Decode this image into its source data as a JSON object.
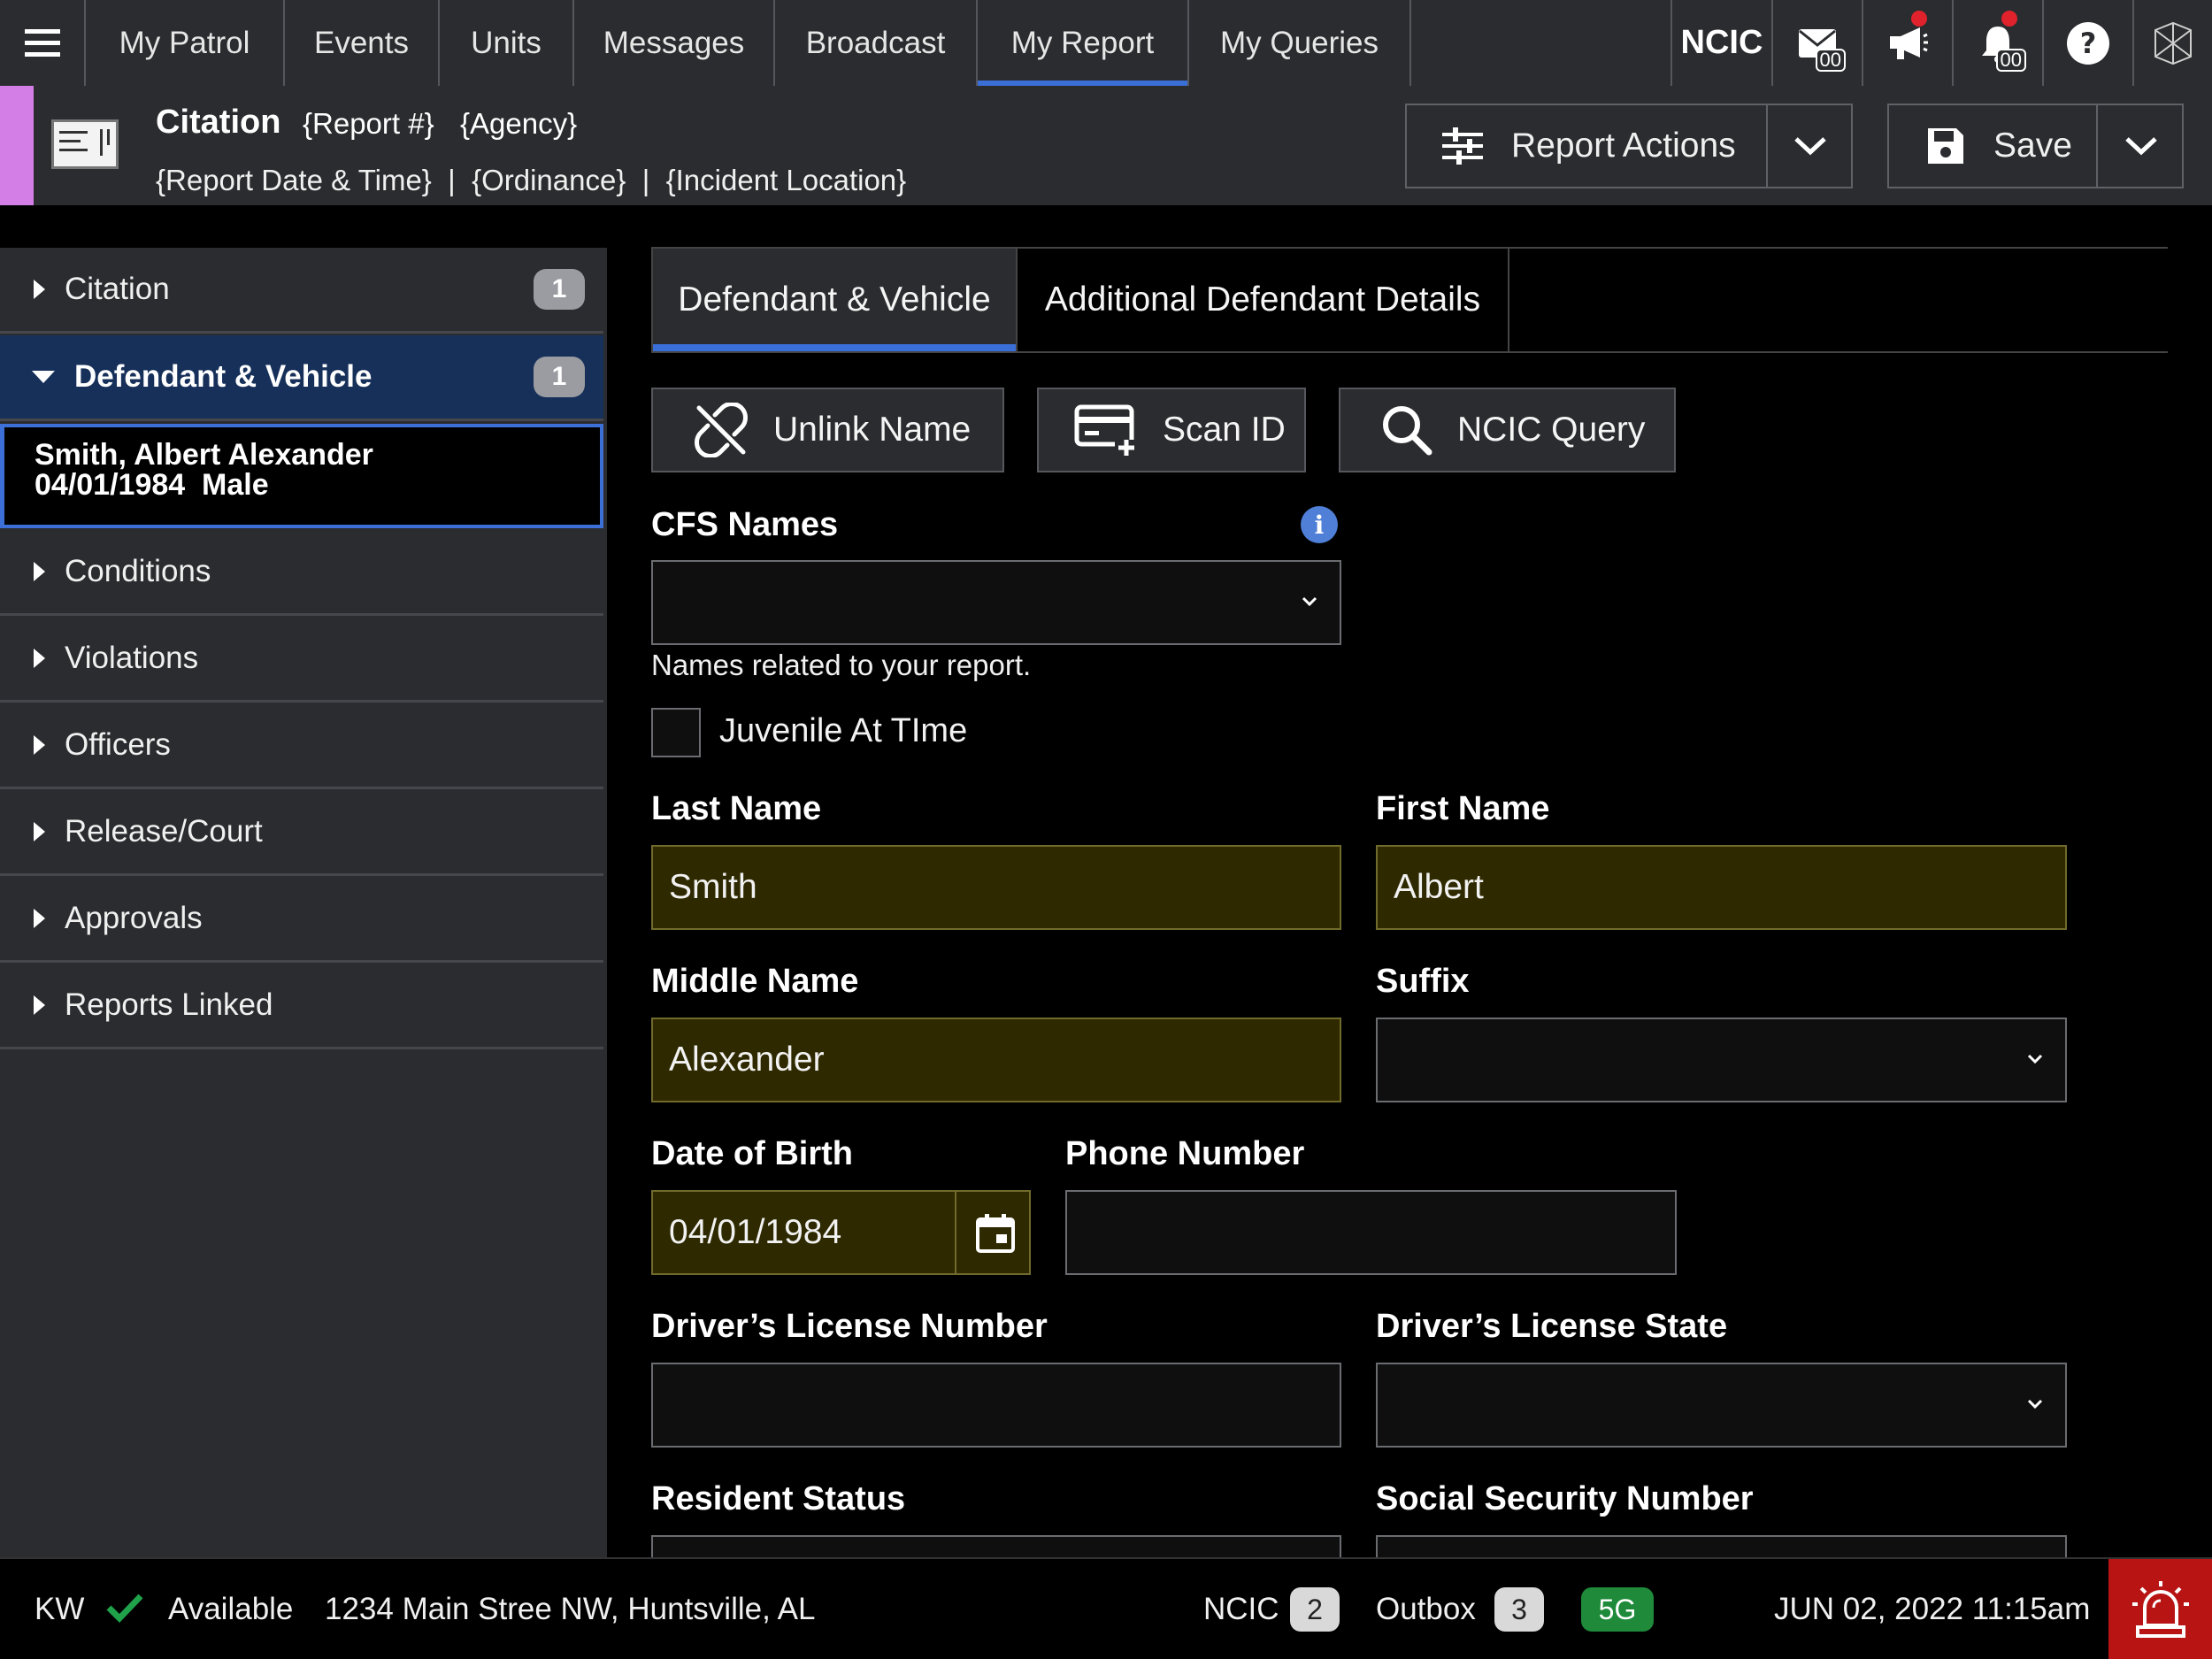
{
  "nav": {
    "tabs": [
      {
        "label": "My Patrol"
      },
      {
        "label": "Events"
      },
      {
        "label": "Units"
      },
      {
        "label": "Messages"
      },
      {
        "label": "Broadcast"
      },
      {
        "label": "My Report",
        "active": true
      },
      {
        "label": "My Queries"
      }
    ],
    "ncic_label": "NCIC",
    "messages_count": "00",
    "notifications_count": "00"
  },
  "header": {
    "title": "Citation",
    "report_num": "{Report #}",
    "agency": "{Agency}",
    "subline": "{Report Date & Time}  |  {Ordinance}  |  {Incident Location}",
    "report_actions_label": "Report Actions",
    "save_label": "Save"
  },
  "sidebar": {
    "items": [
      {
        "label": "Citation",
        "count": "1"
      },
      {
        "label": "Defendant & Vehicle",
        "count": "1",
        "open": true
      },
      {
        "label": "Conditions"
      },
      {
        "label": "Violations"
      },
      {
        "label": "Officers"
      },
      {
        "label": "Release/Court"
      },
      {
        "label": "Approvals"
      },
      {
        "label": "Reports Linked"
      }
    ],
    "person": {
      "name": "Smith, Albert Alexander",
      "details": "04/01/1984  Male"
    }
  },
  "form": {
    "tabs": [
      {
        "label": "Defendant & Vehicle",
        "active": true
      },
      {
        "label": "Additional Defendant Details"
      }
    ],
    "actions": {
      "unlink": "Unlink Name",
      "scan": "Scan ID",
      "ncic": "NCIC Query"
    },
    "cfs_names": {
      "label": "CFS Names",
      "value": "",
      "hint": "Names related to your report."
    },
    "juvenile": {
      "label": "Juvenile At TIme",
      "checked": false
    },
    "last_name": {
      "label": "Last Name",
      "value": "Smith"
    },
    "first_name": {
      "label": "First Name",
      "value": "Albert"
    },
    "middle_name": {
      "label": "Middle Name",
      "value": "Alexander"
    },
    "suffix": {
      "label": "Suffix",
      "value": ""
    },
    "dob": {
      "label": "Date of Birth",
      "value": "04/01/1984"
    },
    "phone": {
      "label": "Phone Number",
      "value": ""
    },
    "dl_number": {
      "label": "Driver’s License Number",
      "value": ""
    },
    "dl_state": {
      "label": "Driver’s License State",
      "value": ""
    },
    "resident_status": {
      "label": "Resident Status"
    },
    "ssn": {
      "label": "Social Security Number"
    }
  },
  "statusbar": {
    "unit": "KW",
    "status": "Available",
    "location": "1234 Main Stree NW, Huntsville, AL",
    "ncic_label": "NCIC",
    "ncic_count": "2",
    "outbox_label": "Outbox",
    "outbox_count": "3",
    "network": "5G",
    "datetime": "JUN 02, 2022 11:15am"
  },
  "colors": {
    "accent_blue": "#3a6fd8",
    "required_field": "#2f2900",
    "report_accent": "#d27ee6",
    "network_green": "#1e8a3a",
    "alarm_red": "#b81414"
  }
}
